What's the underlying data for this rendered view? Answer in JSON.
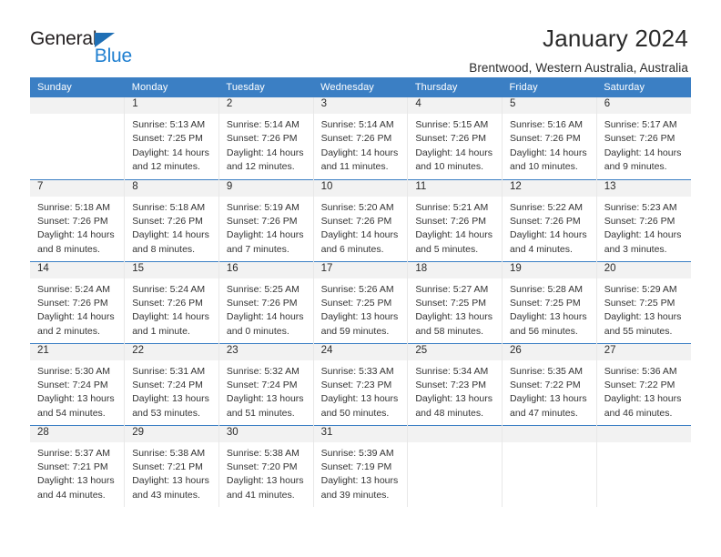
{
  "brand": {
    "name_part1": "General",
    "name_part2": "Blue",
    "triangle_color": "#1f6fb5",
    "blue_color": "#1f7fd0"
  },
  "header": {
    "title": "January 2024",
    "subtitle": "Brentwood, Western Australia, Australia",
    "header_bg": "#3b7fc4",
    "daynum_bg": "#f2f2f2"
  },
  "weekdays": [
    "Sunday",
    "Monday",
    "Tuesday",
    "Wednesday",
    "Thursday",
    "Friday",
    "Saturday"
  ],
  "weeks": [
    [
      {
        "day": "",
        "sunrise": "",
        "sunset": "",
        "daylight1": "",
        "daylight2": ""
      },
      {
        "day": "1",
        "sunrise": "Sunrise: 5:13 AM",
        "sunset": "Sunset: 7:25 PM",
        "daylight1": "Daylight: 14 hours",
        "daylight2": "and 12 minutes."
      },
      {
        "day": "2",
        "sunrise": "Sunrise: 5:14 AM",
        "sunset": "Sunset: 7:26 PM",
        "daylight1": "Daylight: 14 hours",
        "daylight2": "and 12 minutes."
      },
      {
        "day": "3",
        "sunrise": "Sunrise: 5:14 AM",
        "sunset": "Sunset: 7:26 PM",
        "daylight1": "Daylight: 14 hours",
        "daylight2": "and 11 minutes."
      },
      {
        "day": "4",
        "sunrise": "Sunrise: 5:15 AM",
        "sunset": "Sunset: 7:26 PM",
        "daylight1": "Daylight: 14 hours",
        "daylight2": "and 10 minutes."
      },
      {
        "day": "5",
        "sunrise": "Sunrise: 5:16 AM",
        "sunset": "Sunset: 7:26 PM",
        "daylight1": "Daylight: 14 hours",
        "daylight2": "and 10 minutes."
      },
      {
        "day": "6",
        "sunrise": "Sunrise: 5:17 AM",
        "sunset": "Sunset: 7:26 PM",
        "daylight1": "Daylight: 14 hours",
        "daylight2": "and 9 minutes."
      }
    ],
    [
      {
        "day": "7",
        "sunrise": "Sunrise: 5:18 AM",
        "sunset": "Sunset: 7:26 PM",
        "daylight1": "Daylight: 14 hours",
        "daylight2": "and 8 minutes."
      },
      {
        "day": "8",
        "sunrise": "Sunrise: 5:18 AM",
        "sunset": "Sunset: 7:26 PM",
        "daylight1": "Daylight: 14 hours",
        "daylight2": "and 8 minutes."
      },
      {
        "day": "9",
        "sunrise": "Sunrise: 5:19 AM",
        "sunset": "Sunset: 7:26 PM",
        "daylight1": "Daylight: 14 hours",
        "daylight2": "and 7 minutes."
      },
      {
        "day": "10",
        "sunrise": "Sunrise: 5:20 AM",
        "sunset": "Sunset: 7:26 PM",
        "daylight1": "Daylight: 14 hours",
        "daylight2": "and 6 minutes."
      },
      {
        "day": "11",
        "sunrise": "Sunrise: 5:21 AM",
        "sunset": "Sunset: 7:26 PM",
        "daylight1": "Daylight: 14 hours",
        "daylight2": "and 5 minutes."
      },
      {
        "day": "12",
        "sunrise": "Sunrise: 5:22 AM",
        "sunset": "Sunset: 7:26 PM",
        "daylight1": "Daylight: 14 hours",
        "daylight2": "and 4 minutes."
      },
      {
        "day": "13",
        "sunrise": "Sunrise: 5:23 AM",
        "sunset": "Sunset: 7:26 PM",
        "daylight1": "Daylight: 14 hours",
        "daylight2": "and 3 minutes."
      }
    ],
    [
      {
        "day": "14",
        "sunrise": "Sunrise: 5:24 AM",
        "sunset": "Sunset: 7:26 PM",
        "daylight1": "Daylight: 14 hours",
        "daylight2": "and 2 minutes."
      },
      {
        "day": "15",
        "sunrise": "Sunrise: 5:24 AM",
        "sunset": "Sunset: 7:26 PM",
        "daylight1": "Daylight: 14 hours",
        "daylight2": "and 1 minute."
      },
      {
        "day": "16",
        "sunrise": "Sunrise: 5:25 AM",
        "sunset": "Sunset: 7:26 PM",
        "daylight1": "Daylight: 14 hours",
        "daylight2": "and 0 minutes."
      },
      {
        "day": "17",
        "sunrise": "Sunrise: 5:26 AM",
        "sunset": "Sunset: 7:25 PM",
        "daylight1": "Daylight: 13 hours",
        "daylight2": "and 59 minutes."
      },
      {
        "day": "18",
        "sunrise": "Sunrise: 5:27 AM",
        "sunset": "Sunset: 7:25 PM",
        "daylight1": "Daylight: 13 hours",
        "daylight2": "and 58 minutes."
      },
      {
        "day": "19",
        "sunrise": "Sunrise: 5:28 AM",
        "sunset": "Sunset: 7:25 PM",
        "daylight1": "Daylight: 13 hours",
        "daylight2": "and 56 minutes."
      },
      {
        "day": "20",
        "sunrise": "Sunrise: 5:29 AM",
        "sunset": "Sunset: 7:25 PM",
        "daylight1": "Daylight: 13 hours",
        "daylight2": "and 55 minutes."
      }
    ],
    [
      {
        "day": "21",
        "sunrise": "Sunrise: 5:30 AM",
        "sunset": "Sunset: 7:24 PM",
        "daylight1": "Daylight: 13 hours",
        "daylight2": "and 54 minutes."
      },
      {
        "day": "22",
        "sunrise": "Sunrise: 5:31 AM",
        "sunset": "Sunset: 7:24 PM",
        "daylight1": "Daylight: 13 hours",
        "daylight2": "and 53 minutes."
      },
      {
        "day": "23",
        "sunrise": "Sunrise: 5:32 AM",
        "sunset": "Sunset: 7:24 PM",
        "daylight1": "Daylight: 13 hours",
        "daylight2": "and 51 minutes."
      },
      {
        "day": "24",
        "sunrise": "Sunrise: 5:33 AM",
        "sunset": "Sunset: 7:23 PM",
        "daylight1": "Daylight: 13 hours",
        "daylight2": "and 50 minutes."
      },
      {
        "day": "25",
        "sunrise": "Sunrise: 5:34 AM",
        "sunset": "Sunset: 7:23 PM",
        "daylight1": "Daylight: 13 hours",
        "daylight2": "and 48 minutes."
      },
      {
        "day": "26",
        "sunrise": "Sunrise: 5:35 AM",
        "sunset": "Sunset: 7:22 PM",
        "daylight1": "Daylight: 13 hours",
        "daylight2": "and 47 minutes."
      },
      {
        "day": "27",
        "sunrise": "Sunrise: 5:36 AM",
        "sunset": "Sunset: 7:22 PM",
        "daylight1": "Daylight: 13 hours",
        "daylight2": "and 46 minutes."
      }
    ],
    [
      {
        "day": "28",
        "sunrise": "Sunrise: 5:37 AM",
        "sunset": "Sunset: 7:21 PM",
        "daylight1": "Daylight: 13 hours",
        "daylight2": "and 44 minutes."
      },
      {
        "day": "29",
        "sunrise": "Sunrise: 5:38 AM",
        "sunset": "Sunset: 7:21 PM",
        "daylight1": "Daylight: 13 hours",
        "daylight2": "and 43 minutes."
      },
      {
        "day": "30",
        "sunrise": "Sunrise: 5:38 AM",
        "sunset": "Sunset: 7:20 PM",
        "daylight1": "Daylight: 13 hours",
        "daylight2": "and 41 minutes."
      },
      {
        "day": "31",
        "sunrise": "Sunrise: 5:39 AM",
        "sunset": "Sunset: 7:19 PM",
        "daylight1": "Daylight: 13 hours",
        "daylight2": "and 39 minutes."
      },
      {
        "day": "",
        "sunrise": "",
        "sunset": "",
        "daylight1": "",
        "daylight2": ""
      },
      {
        "day": "",
        "sunrise": "",
        "sunset": "",
        "daylight1": "",
        "daylight2": ""
      },
      {
        "day": "",
        "sunrise": "",
        "sunset": "",
        "daylight1": "",
        "daylight2": ""
      }
    ]
  ]
}
